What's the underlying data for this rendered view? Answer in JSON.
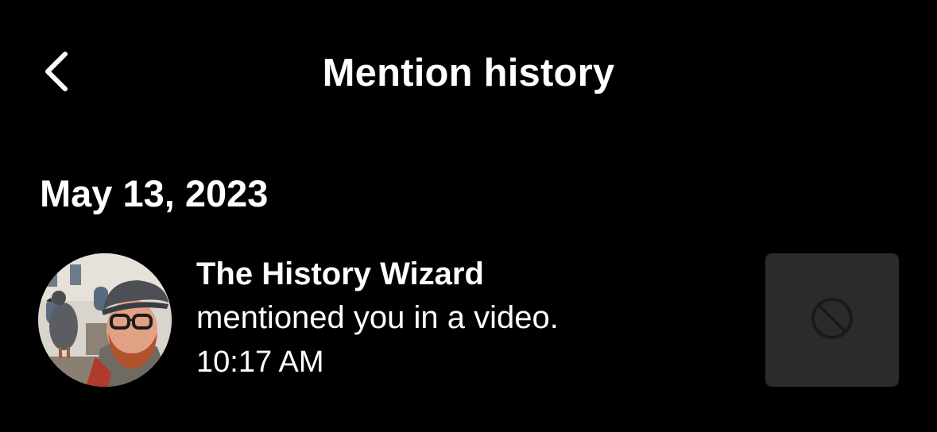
{
  "header": {
    "title": "Mention history",
    "back_icon": "chevron-left-icon"
  },
  "sections": [
    {
      "date": "May 13, 2023",
      "items": [
        {
          "user_name": "The History Wizard",
          "action": "mentioned you in a video.",
          "time": "10:17 AM",
          "thumbnail_icon": "unavailable-icon"
        }
      ]
    }
  ],
  "colors": {
    "background": "#000000",
    "text": "#ffffff",
    "thumbnail_bg": "#2b2b2b",
    "thumbnail_icon": "#1a1a1a"
  }
}
